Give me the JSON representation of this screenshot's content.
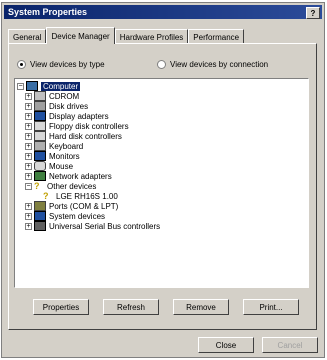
{
  "window": {
    "title": "System Properties",
    "help_label": "?"
  },
  "tabs": [
    {
      "label": "General"
    },
    {
      "label": "Device Manager"
    },
    {
      "label": "Hardware Profiles"
    },
    {
      "label": "Performance"
    }
  ],
  "view": {
    "by_type": "View devices by type",
    "by_connection": "View devices by connection"
  },
  "tree": {
    "root": "Computer",
    "items": [
      {
        "label": "CDROM"
      },
      {
        "label": "Disk drives"
      },
      {
        "label": "Display adapters"
      },
      {
        "label": "Floppy disk controllers"
      },
      {
        "label": "Hard disk controllers"
      },
      {
        "label": "Keyboard"
      },
      {
        "label": "Monitors"
      },
      {
        "label": "Mouse"
      },
      {
        "label": "Network adapters"
      },
      {
        "label": "Other devices"
      },
      {
        "label": "LGE RH16S 1.00"
      },
      {
        "label": "Ports (COM & LPT)"
      },
      {
        "label": "System devices"
      },
      {
        "label": "Universal Serial Bus controllers"
      }
    ]
  },
  "buttons": {
    "properties": "Properties",
    "refresh": "Refresh",
    "remove": "Remove",
    "print": "Print...",
    "close": "Close",
    "cancel": "Cancel"
  }
}
